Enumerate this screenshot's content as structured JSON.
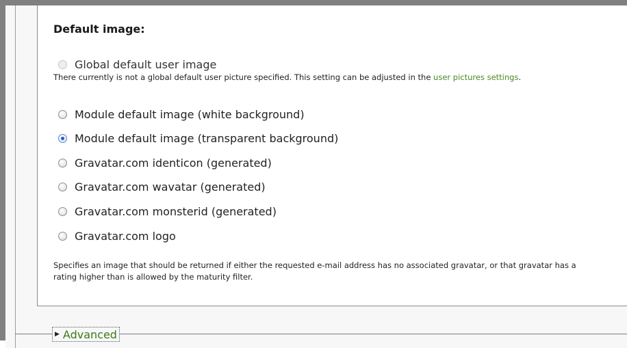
{
  "fieldset": {
    "title": "Default image:",
    "options": [
      {
        "label": "Global default user image",
        "checked": false,
        "disabled": true
      },
      {
        "label": "Module default image (white background)",
        "checked": false,
        "disabled": false
      },
      {
        "label": "Module default image (transparent background)",
        "checked": true,
        "disabled": false
      },
      {
        "label": "Gravatar.com identicon (generated)",
        "checked": false,
        "disabled": false
      },
      {
        "label": "Gravatar.com wavatar (generated)",
        "checked": false,
        "disabled": false
      },
      {
        "label": "Gravatar.com monsterid (generated)",
        "checked": false,
        "disabled": false
      },
      {
        "label": "Gravatar.com logo",
        "checked": false,
        "disabled": false
      }
    ],
    "global_note_prefix": "There currently is not a global default user picture specified. This setting can be adjusted in the ",
    "global_note_link": "user pictures settings",
    "global_note_suffix": ".",
    "help_text": "Specifies an image that should be returned if either the requested e-mail address has no associated gravatar, or that gravatar has a rating higher than is allowed by the maturity filter."
  },
  "advanced": {
    "label": "Advanced",
    "expander_icon": "triangle-right-icon"
  },
  "colors": {
    "link": "#4a8a2a",
    "checked": "#1f5fbf"
  }
}
